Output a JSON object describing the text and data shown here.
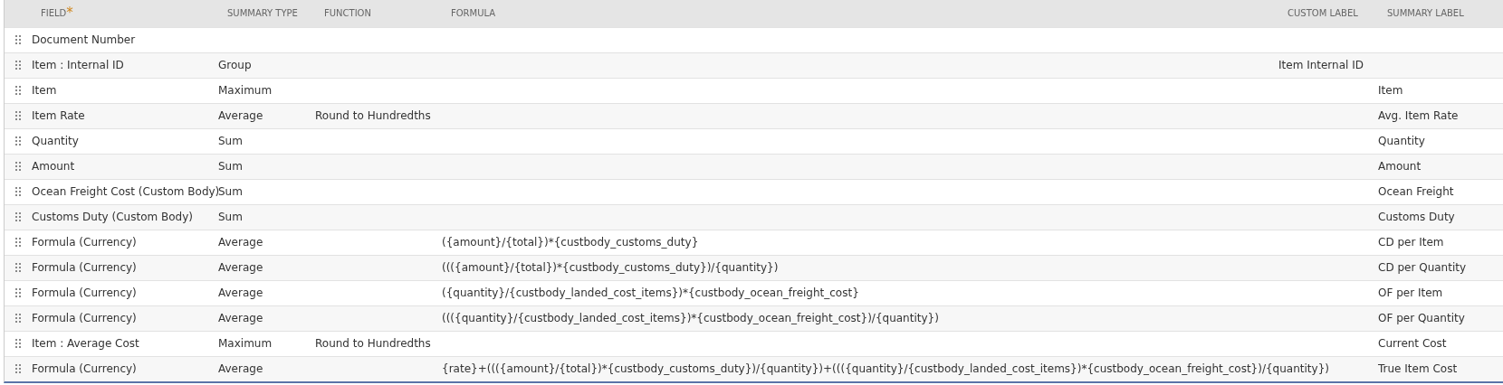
{
  "table": {
    "columns": [
      {
        "label": "FIELD",
        "required_mark": "*"
      },
      {
        "label": "SUMMARY TYPE"
      },
      {
        "label": "FUNCTION"
      },
      {
        "label": "FORMULA"
      },
      {
        "label": "CUSTOM LABEL"
      },
      {
        "label": "SUMMARY LABEL"
      }
    ],
    "rows": [
      {
        "field": "Document Number"
      },
      {
        "field": "Item : Internal ID",
        "summary_type": "Group",
        "custom_label": "Item Internal ID"
      },
      {
        "field": "Item",
        "summary_type": "Maximum",
        "summary_label": "Item"
      },
      {
        "field": "Item Rate",
        "summary_type": "Average",
        "function": "Round to Hundredths",
        "summary_label": "Avg. Item Rate"
      },
      {
        "field": "Quantity",
        "summary_type": "Sum",
        "summary_label": "Quantity"
      },
      {
        "field": "Amount",
        "summary_type": "Sum",
        "summary_label": "Amount"
      },
      {
        "field": "Ocean Freight Cost (Custom Body)",
        "summary_type": "Sum",
        "summary_label": "Ocean Freight"
      },
      {
        "field": "Customs Duty (Custom Body)",
        "summary_type": "Sum",
        "summary_label": "Customs Duty"
      },
      {
        "field": "Formula (Currency)",
        "summary_type": "Average",
        "formula": "({amount}/{total})*{custbody_customs_duty}",
        "summary_label": "CD per Item"
      },
      {
        "field": "Formula (Currency)",
        "summary_type": "Average",
        "formula": "((({amount}/{total})*{custbody_customs_duty})/{quantity})",
        "summary_label": "CD per Quantity"
      },
      {
        "field": "Formula (Currency)",
        "summary_type": "Average",
        "formula": "({quantity}/{custbody_landed_cost_items})*{custbody_ocean_freight_cost}",
        "summary_label": "OF per Item"
      },
      {
        "field": "Formula (Currency)",
        "summary_type": "Average",
        "formula": "((({quantity}/{custbody_landed_cost_items})*{custbody_ocean_freight_cost})/{quantity})",
        "summary_label": "OF per Quantity"
      },
      {
        "field": "Item : Average Cost",
        "summary_type": "Maximum",
        "function": "Round to Hundredths",
        "summary_label": "Current Cost"
      },
      {
        "field": "Formula (Currency)",
        "summary_type": "Average",
        "formula": "{rate}+((({amount}/{total})*{custbody_customs_duty})/{quantity})+((({quantity}/{custbody_landed_cost_items})*{custbody_ocean_freight_cost})/{quantity})",
        "summary_label": "True Item Cost"
      }
    ]
  }
}
